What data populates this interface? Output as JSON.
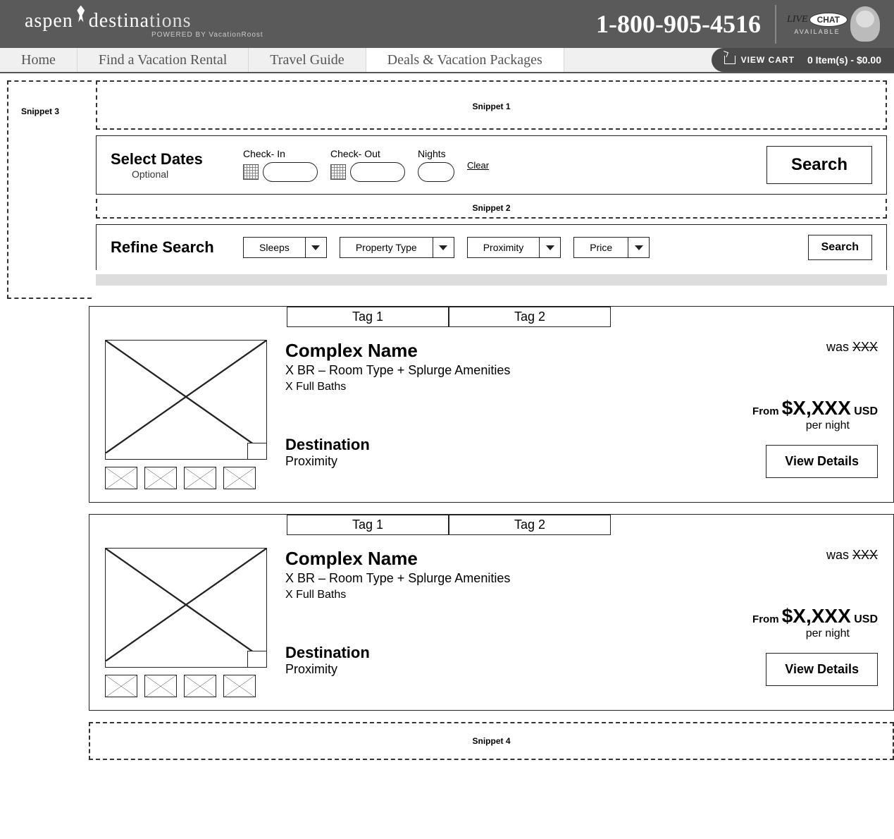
{
  "header": {
    "logo_a": "aspen",
    "logo_b": "destina",
    "logo_c": "tions",
    "powered": "POWERED BY VacationRoost",
    "phone": "1-800-905-4516",
    "chat_live": "LIVE",
    "chat_bubble": "CHAT",
    "chat_status": "AVAILABLE"
  },
  "nav": {
    "items": [
      "Home",
      "Find a Vacation Rental",
      "Travel Guide",
      "Deals & Vacation Packages"
    ],
    "cart_label": "VIEW CART",
    "cart_info": "0 Item(s) - $0.00"
  },
  "snippets": {
    "s1": "Snippet 1",
    "s2": "Snippet 2",
    "s3": "Snippet 3",
    "s4": "Snippet 4"
  },
  "dates": {
    "title": "Select Dates",
    "subtitle": "Optional",
    "checkin": "Check- In",
    "checkout": "Check- Out",
    "nights": "Nights",
    "clear": "Clear",
    "search": "Search"
  },
  "refine": {
    "title": "Refine Search",
    "filters": [
      "Sleeps",
      "Property Type",
      "Proximity",
      "Price"
    ],
    "search": "Search"
  },
  "listings": [
    {
      "tags": [
        "Tag 1",
        "Tag 2"
      ],
      "name": "Complex Name",
      "room": "X BR – Room Type + Splurge Amenities",
      "baths": "X Full Baths",
      "destination": "Destination",
      "proximity": "Proximity",
      "was_label": "was ",
      "was_price": "XXX",
      "from": "From ",
      "price": "$X,XXX",
      "currency": " USD",
      "per": "per night",
      "button": "View Details"
    },
    {
      "tags": [
        "Tag 1",
        "Tag 2"
      ],
      "name": "Complex Name",
      "room": "X BR – Room Type + Splurge Amenities",
      "baths": "X Full Baths",
      "destination": "Destination",
      "proximity": "Proximity",
      "was_label": "was ",
      "was_price": "XXX",
      "from": "From ",
      "price": "$X,XXX",
      "currency": " USD",
      "per": "per night",
      "button": "View Details"
    }
  ]
}
